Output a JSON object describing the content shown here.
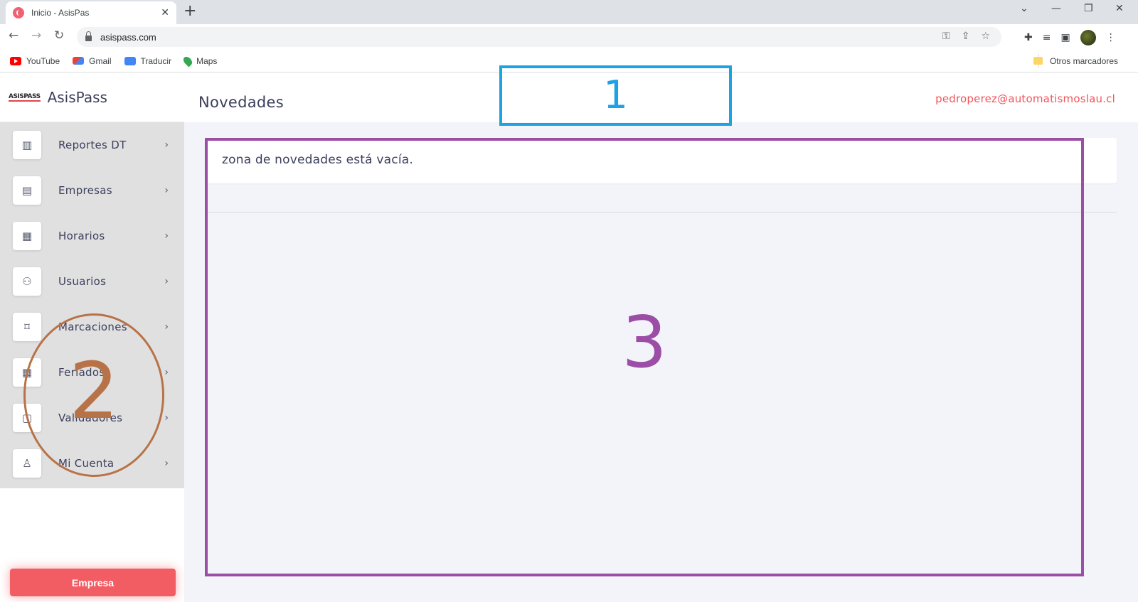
{
  "browser": {
    "tab_title": "Inicio - AsisPas",
    "url": "asispass.com",
    "bookmarks": [
      {
        "label": "YouTube",
        "icon": "youtube-icon"
      },
      {
        "label": "Gmail",
        "icon": "gmail-icon"
      },
      {
        "label": "Traducir",
        "icon": "translate-icon"
      },
      {
        "label": "Maps",
        "icon": "maps-icon"
      }
    ],
    "other_bookmarks": "Otros marcadores"
  },
  "sidebar": {
    "brand_logo": "ASISPASS",
    "brand_name": "AsisPass",
    "items": [
      {
        "label": "Reportes DT",
        "icon": "bar-chart-icon"
      },
      {
        "label": "Empresas",
        "icon": "clipboard-icon"
      },
      {
        "label": "Horarios",
        "icon": "calendar-icon"
      },
      {
        "label": "Usuarios",
        "icon": "users-icon"
      },
      {
        "label": "Marcaciones",
        "icon": "bookmark-icon"
      },
      {
        "label": "Feriados",
        "icon": "calendar-icon"
      },
      {
        "label": "Validadores",
        "icon": "lock-icon"
      },
      {
        "label": "Mi Cuenta",
        "icon": "user-icon"
      }
    ],
    "company_button": "Empresa"
  },
  "header": {
    "title": "Novedades",
    "user_email": "pedroperez@automatismoslau.cl"
  },
  "main": {
    "news_empty_text": "zona de novedades está vacía."
  },
  "annotations": {
    "label_1": "1",
    "label_2": "2",
    "label_3": "3",
    "colors": {
      "label_1": "#1ea2e3",
      "label_2": "#b87247",
      "label_3": "#9c4ea6"
    }
  },
  "colors": {
    "accent": "#f25d64",
    "email": "#f2545b",
    "text": "#3b3f5c"
  }
}
